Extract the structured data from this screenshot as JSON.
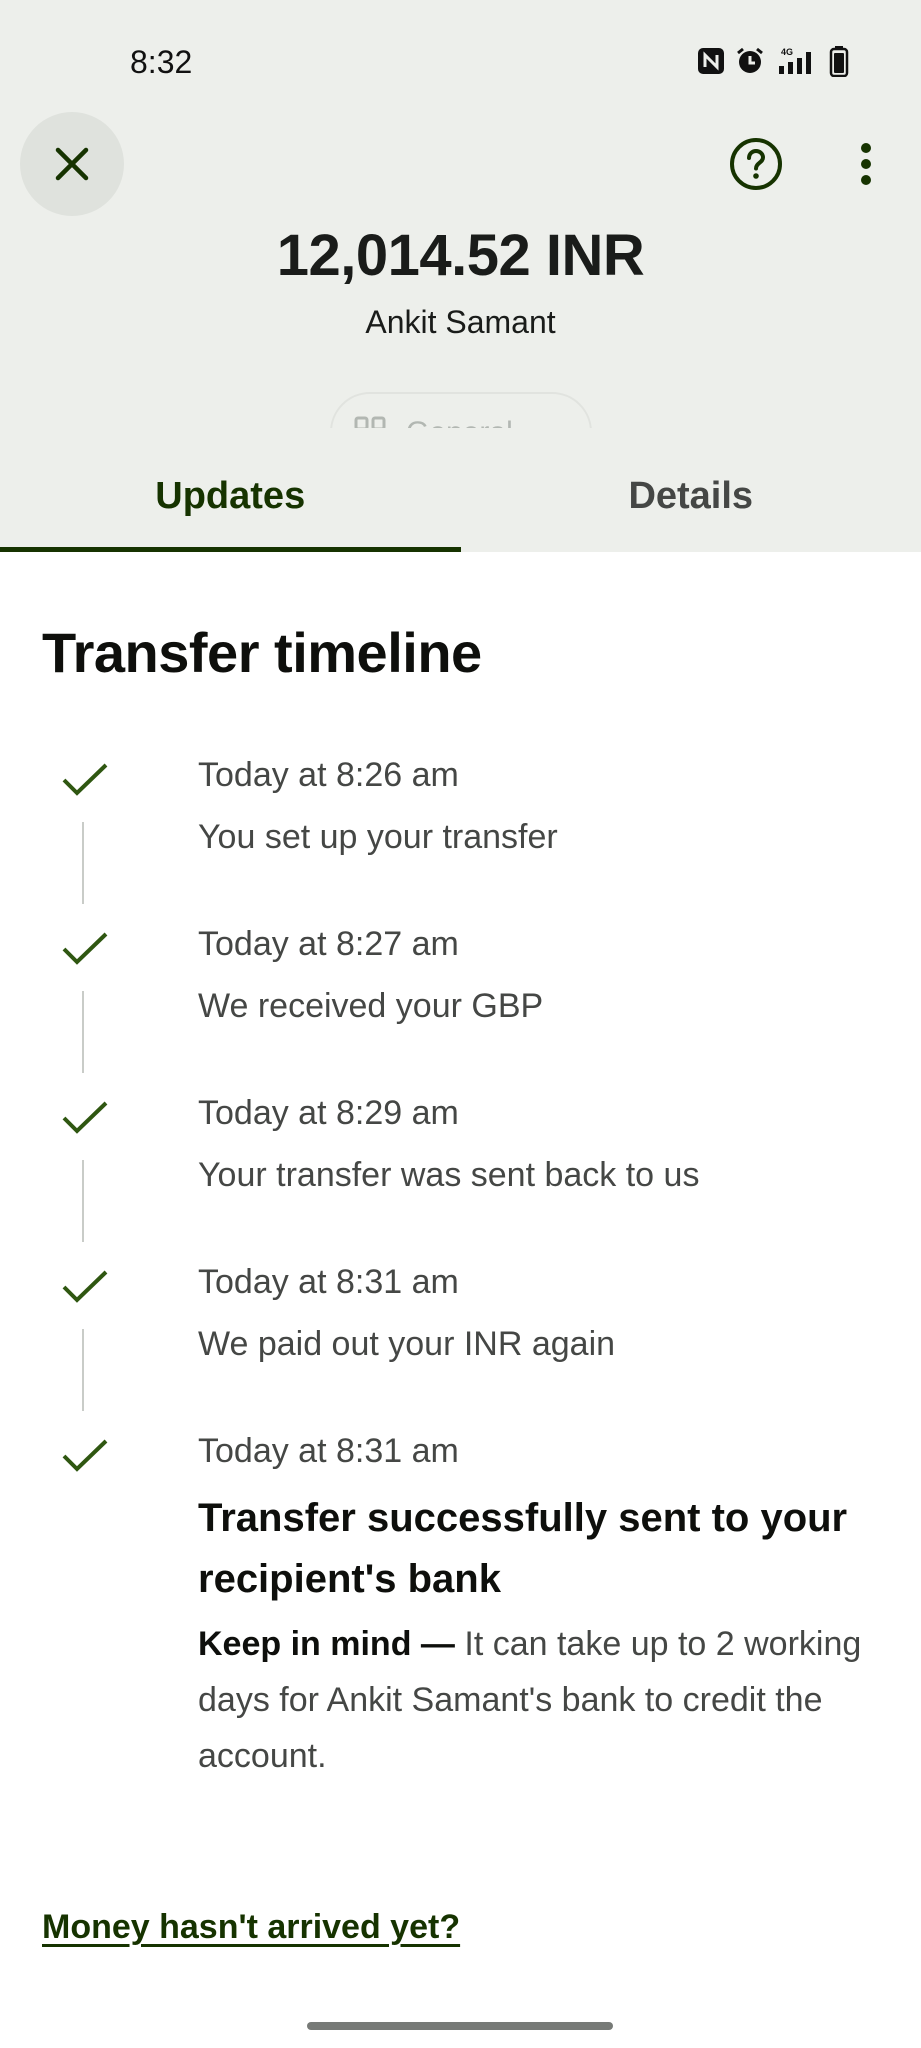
{
  "status_bar": {
    "time": "8:32",
    "icons": [
      "nfc-icon",
      "alarm-icon",
      "signal-4g-icon",
      "battery-icon"
    ],
    "network_label": "4G"
  },
  "header": {
    "amount": "12,014.52 INR",
    "recipient": "Ankit Samant",
    "category_chip": "General",
    "background": "#edefeb"
  },
  "tabs": [
    {
      "label": "Updates",
      "active": true
    },
    {
      "label": "Details",
      "active": false
    }
  ],
  "timeline": {
    "title": "Transfer timeline",
    "items": [
      {
        "time": "Today at 8:26 am",
        "description": "You set up your transfer",
        "done": true
      },
      {
        "time": "Today at 8:27 am",
        "description": "We received your GBP",
        "done": true
      },
      {
        "time": "Today at 8:29 am",
        "description": "Your transfer was sent back to us",
        "done": true
      },
      {
        "time": "Today at 8:31 am",
        "description": "We paid out your INR again",
        "done": true
      },
      {
        "time": "Today at 8:31 am",
        "description": "Transfer successfully sent to your recipient's bank",
        "done": true,
        "note_label": "Keep in mind —",
        "note_text": "It can take up to 2 working days for Ankit Samant's bank to credit the account."
      }
    ]
  },
  "help_link": "Money hasn't arrived yet?",
  "colors": {
    "accent_dark_green": "#163300",
    "check_green": "#2f5711",
    "text_secondary": "#454745"
  }
}
